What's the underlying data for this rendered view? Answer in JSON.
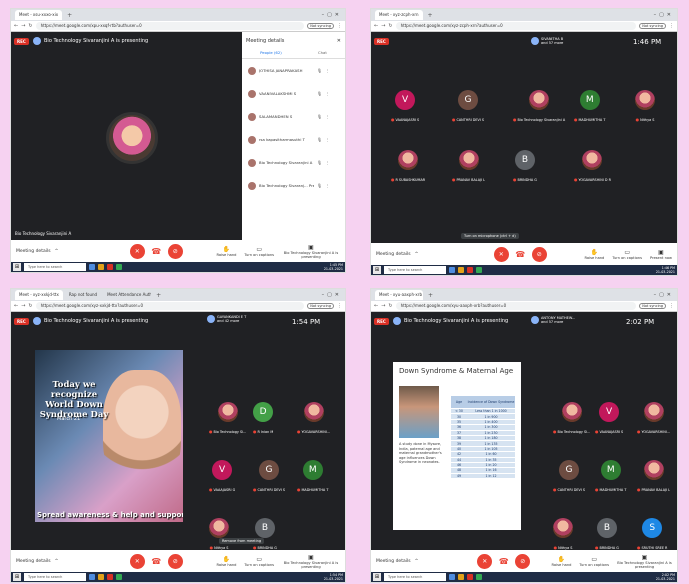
{
  "panels": [
    {
      "tabs": [
        "Meet - xsu-xxxo-xix"
      ],
      "url": "https://meet.google.com/xpu-xxqf-rtb?authuser=0",
      "not_syncing": "Not syncing",
      "presenting": "Bio Technology Sivaranjini A is presenting",
      "self_name": "Bio Technology Sivaranjini A",
      "side_panel": {
        "title": "Meeting details",
        "tab_people": "People (62)",
        "tab_chat": "Chat",
        "people": [
          "JOTHISA JANAPRAKASH",
          "VAANIVALAKSHMI S",
          "SALAMANDHEN S",
          "rsa kapasitharmasuthi T",
          "Bio Technology Sivaranjini A",
          "Bio Technology Sivaranj... Presentation"
        ]
      },
      "meeting_details": "Meeting details",
      "actions": [
        "Raise hand",
        "Turn on captions",
        "Bio Technology Sivaranjini A is presenting"
      ],
      "taskbar": {
        "search": "Type here to search",
        "time": "1:45 PM",
        "date": "21-03-2021"
      }
    },
    {
      "tabs": [
        "Meet - xyz-zcph-xrn"
      ],
      "url": "https://meet.google.com/xyz-zcph-xrn?authuser=0",
      "not_syncing": "Not syncing",
      "top_info_name": "SIVANITHA B",
      "top_info_more": "and 57 more",
      "time": "1:46 PM",
      "participants": [
        {
          "name": "VAANAJASRI S",
          "initial": "V",
          "color": "#c2185b",
          "photo": false
        },
        {
          "name": "CANTHRI DEVI S",
          "initial": "G",
          "color": "#6d4c41",
          "photo": false
        },
        {
          "name": "Bio Technology Sivaranjini A",
          "initial": "",
          "color": "",
          "photo": true
        },
        {
          "name": "MADHUMITHA T",
          "initial": "M",
          "color": "#2e7d32",
          "photo": false
        },
        {
          "name": "Nithya S",
          "initial": "",
          "color": "",
          "photo": true
        },
        {
          "name": "R SUBASHKUMAR",
          "initial": "",
          "color": "",
          "photo": true
        },
        {
          "name": "PRANAV BALAJI L",
          "initial": "",
          "color": "",
          "photo": true
        },
        {
          "name": "BRINDHA G",
          "initial": "B",
          "color": "#5f6368",
          "photo": false
        },
        {
          "name": "YOGAVARSHINI D R",
          "initial": "",
          "color": "",
          "photo": true
        }
      ],
      "tooltip": "Turn on microphone (ctrl + d)",
      "meeting_details": "Meeting details",
      "actions": [
        "Raise hand",
        "Turn on captions",
        "Present now"
      ],
      "taskbar": {
        "search": "Type here to search",
        "time": "1:46 PM",
        "date": "21-03-2021"
      }
    },
    {
      "tabs": [
        "Meet - xyz-xxkjd-ttx",
        "Rap not found",
        "Meet Attendance Authorize"
      ],
      "url": "https://meet.google.com/xyz-xxkjd-ttx?authuser=0",
      "not_syncing": "Not syncing",
      "presenting": "Bio Technology Sivaranjini A is presenting",
      "top_info_name": "GAYANKANDI E T",
      "top_info_more": "and 42 more",
      "time": "1:54 PM",
      "slide": {
        "line1": "Today we recognize",
        "line2": "World Down",
        "line3": "Syndrome Day",
        "date": "March 21",
        "banner": "Spread awareness & help and support"
      },
      "participants": [
        {
          "name": "Bio Technology Si...",
          "initial": "",
          "color": "",
          "photo": true
        },
        {
          "name": "R Inian M",
          "initial": "D",
          "color": "#43a047",
          "photo": false
        },
        {
          "name": "YOGAVARSHINI...",
          "initial": "",
          "color": "",
          "photo": true
        },
        {
          "name": "VAAAJASRI G",
          "initial": "V",
          "color": "#c2185b",
          "photo": false
        },
        {
          "name": "CANTHRI DEVI S",
          "initial": "G",
          "color": "#6d4c41",
          "photo": false
        },
        {
          "name": "MADHUMITHA T",
          "initial": "M",
          "color": "#2e7d32",
          "photo": false
        },
        {
          "name": "Nithya S",
          "initial": "",
          "color": "",
          "photo": true
        },
        {
          "name": "BRINDHA G",
          "initial": "B",
          "color": "#5f6368",
          "photo": false
        }
      ],
      "tooltip": "Remove from meeting",
      "meeting_details": "Meeting details",
      "actions": [
        "Raise hand",
        "Turn on captions",
        "Bio Technology Sivaranjini A is presenting"
      ],
      "taskbar": {
        "search": "Type here to search",
        "time": "1:54 PM",
        "date": "21-03-2021"
      }
    },
    {
      "tabs": [
        "Meet - xyu-aaxph-xrb"
      ],
      "url": "https://meet.google.com/xyu-aaxph-xrb?authuser=0",
      "not_syncing": "Not syncing",
      "presenting": "Bio Technology Sivaranjini A is presenting",
      "top_info_name": "ANTONY MATHEW...",
      "top_info_more": "and 57 more",
      "time": "2:02 PM",
      "slide": {
        "title": "Down Syndrome & Maternal Age",
        "text": "A study done in Mysore, India, paternal age and maternal grandmother's age influences Down Syndrome in neonates.",
        "col1": "Age",
        "col2": "Incidence of Down Syndrome",
        "rows": [
          [
            "< 30",
            "Less than 1 in 1000"
          ],
          [
            "30",
            "1 in 900"
          ],
          [
            "35",
            "1 in 400"
          ],
          [
            "36",
            "1 in 300"
          ],
          [
            "37",
            "1 in 230"
          ],
          [
            "38",
            "1 in 180"
          ],
          [
            "39",
            "1 in 135"
          ],
          [
            "40",
            "1 in 105"
          ],
          [
            "42",
            "1 in 60"
          ],
          [
            "44",
            "1 in 35"
          ],
          [
            "46",
            "1 in 20"
          ],
          [
            "48",
            "1 in 16"
          ],
          [
            "49",
            "1 in 12"
          ]
        ]
      },
      "participants": [
        {
          "name": "Bio Technology Si...",
          "initial": "",
          "color": "",
          "photo": true
        },
        {
          "name": "VAANAJASRI S",
          "initial": "V",
          "color": "#c2185b",
          "photo": false
        },
        {
          "name": "YOGAVARSHINI...",
          "initial": "",
          "color": "",
          "photo": true
        },
        {
          "name": "CANTHRI DEVI S",
          "initial": "G",
          "color": "#6d4c41",
          "photo": false
        },
        {
          "name": "MADHUMITHA T",
          "initial": "M",
          "color": "#2e7d32",
          "photo": false
        },
        {
          "name": "PRANAV BALAJI L",
          "initial": "",
          "color": "",
          "photo": true
        },
        {
          "name": "Nithya S",
          "initial": "",
          "color": "",
          "photo": true
        },
        {
          "name": "BRINDHA G",
          "initial": "B",
          "color": "#5f6368",
          "photo": false
        },
        {
          "name": "SRUTHI SREE R",
          "initial": "S",
          "color": "#1e88e5",
          "photo": false
        }
      ],
      "meeting_details": "Meeting details",
      "actions": [
        "Raise hand",
        "Turn on captions",
        "Bio Technology Sivaranjini A is presenting"
      ],
      "taskbar": {
        "search": "Type here to search",
        "time": "2:02 PM",
        "date": "21-03-2021"
      }
    }
  ],
  "icons": {
    "rec": "REC",
    "mic_off": "mic-off-icon",
    "cam_off": "camera-off-icon",
    "end": "phone-end-icon"
  }
}
